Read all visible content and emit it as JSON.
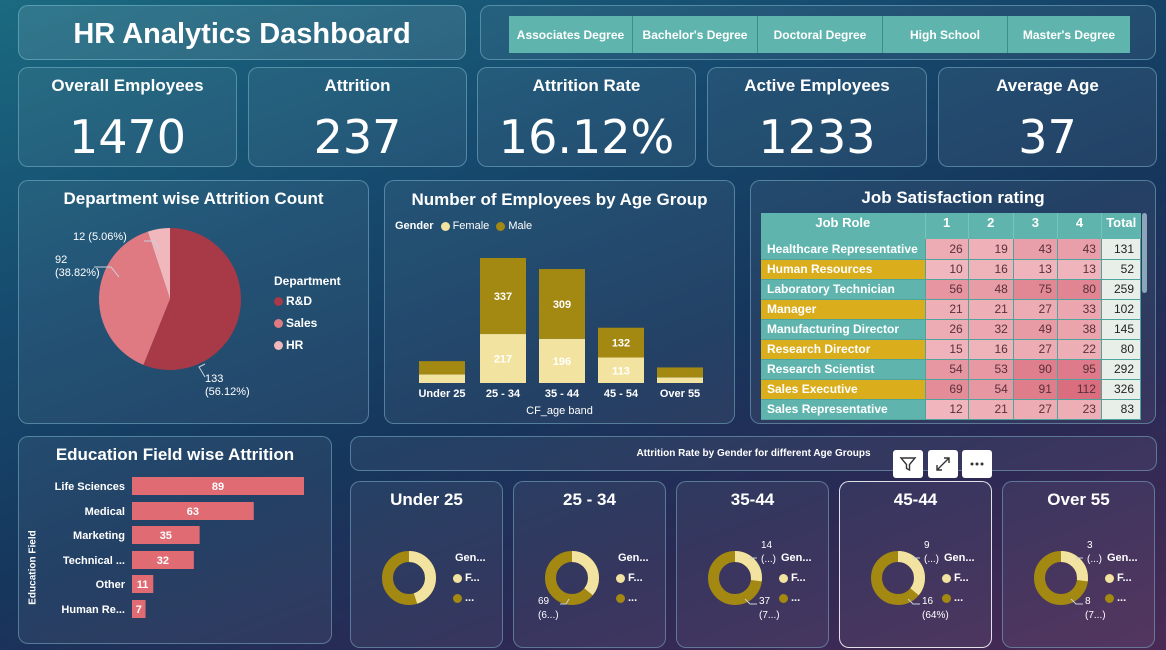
{
  "header": {
    "title": "HR Analytics Dashboard"
  },
  "slicer": {
    "options": [
      "Associates Degree",
      "Bachelor's Degree",
      "Doctoral Degree",
      "High School",
      "Master's Degree"
    ]
  },
  "kpis": [
    {
      "label": "Overall Employees",
      "value": "1470"
    },
    {
      "label": "Attrition",
      "value": "237"
    },
    {
      "label": "Attrition Rate",
      "value": "16.12%"
    },
    {
      "label": "Active Employees",
      "value": "1233"
    },
    {
      "label": "Average Age",
      "value": "37"
    }
  ],
  "dept_chart": {
    "title": "Department wise Attrition Count",
    "legend_title": "Department",
    "colors": {
      "R&D": "#a83a48",
      "Sales": "#e07a82",
      "HR": "#f0b8bc"
    },
    "chart_data": {
      "type": "pie",
      "categories": [
        "R&D",
        "Sales",
        "HR"
      ],
      "values": [
        133,
        92,
        12
      ],
      "labels": [
        "133\n(56.12%)",
        "92\n(38.82%)",
        "12 (5.06%)"
      ]
    },
    "labels": {
      "rd_value": "133",
      "rd_pct": "(56.12%)",
      "sales_value": "92",
      "sales_pct": "(38.82%)",
      "hr_label": "12 (5.06%)"
    }
  },
  "age_chart": {
    "title": "Number of Employees by Age Group",
    "legend_title": "Gender",
    "legend": [
      "Female",
      "Male"
    ],
    "xlabel": "CF_age band",
    "colors": {
      "Female": "#f3e3a0",
      "Male": "#a38811"
    },
    "chart_data": {
      "type": "bar",
      "stacked": true,
      "categories": [
        "Under 25",
        "25 - 34",
        "35 - 44",
        "45 - 54",
        "Over 55"
      ],
      "series": [
        {
          "name": "Female",
          "values": [
            38,
            217,
            196,
            113,
            25
          ]
        },
        {
          "name": "Male",
          "values": [
            59,
            337,
            309,
            132,
            44
          ]
        }
      ],
      "data_labels": {
        "Female": [
          "",
          "217",
          "196",
          "113",
          ""
        ],
        "Male": [
          "",
          "337",
          "309",
          "132",
          ""
        ]
      }
    }
  },
  "job_sat": {
    "title": "Job Satisfaction rating",
    "headers": [
      "Job Role",
      "1",
      "2",
      "3",
      "4",
      "Total"
    ],
    "rows": [
      {
        "role": "Healthcare Representative",
        "v": [
          "26",
          "19",
          "43",
          "43"
        ],
        "total": "131"
      },
      {
        "role": "Human Resources",
        "v": [
          "10",
          "16",
          "13",
          "13"
        ],
        "total": "52"
      },
      {
        "role": "Laboratory Technician",
        "v": [
          "56",
          "48",
          "75",
          "80"
        ],
        "total": "259"
      },
      {
        "role": "Manager",
        "v": [
          "21",
          "21",
          "27",
          "33"
        ],
        "total": "102"
      },
      {
        "role": "Manufacturing Director",
        "v": [
          "26",
          "32",
          "49",
          "38"
        ],
        "total": "145"
      },
      {
        "role": "Research Director",
        "v": [
          "15",
          "16",
          "27",
          "22"
        ],
        "total": "80"
      },
      {
        "role": "Research Scientist",
        "v": [
          "54",
          "53",
          "90",
          "95"
        ],
        "total": "292"
      },
      {
        "role": "Sales Executive",
        "v": [
          "69",
          "54",
          "91",
          "112"
        ],
        "total": "326"
      },
      {
        "role": "Sales Representative",
        "v": [
          "12",
          "21",
          "27",
          "23"
        ],
        "total": "83"
      }
    ]
  },
  "edu_chart": {
    "title": "Education Field wise Attrition",
    "ylabel": "Education Field",
    "color": "#e06b73",
    "chart_data": {
      "type": "bar",
      "orientation": "horizontal",
      "categories": [
        "Life Sciences",
        "Medical",
        "Marketing",
        "Technical ...",
        "Other",
        "Human Re..."
      ],
      "values": [
        89,
        63,
        35,
        32,
        11,
        7
      ]
    }
  },
  "gender_section": {
    "title": "Attrition Rate by Gender for different Age Groups",
    "legend_title": "Gen...",
    "legend_items": [
      "F...",
      "..."
    ],
    "colors": {
      "female": "#f3e3a0",
      "male": "#a38811"
    },
    "cards": [
      {
        "title": "Under 25",
        "female": 0.45,
        "male": 0.55,
        "labels": []
      },
      {
        "title": "25 - 34",
        "female": 0.36,
        "male": 0.64,
        "labels": [
          "69",
          "(6...)"
        ]
      },
      {
        "title": "35-44",
        "female": 0.27,
        "male": 0.73,
        "labels": [
          "14",
          "(...)",
          "37",
          "(7...)"
        ]
      },
      {
        "title": "45-44",
        "female": 0.36,
        "male": 0.64,
        "labels": [
          "9",
          "(...)",
          "16",
          "(64%)"
        ]
      },
      {
        "title": "Over 55",
        "female": 0.27,
        "male": 0.73,
        "labels": [
          "3",
          "(...)",
          "8",
          "(7...)"
        ]
      }
    ]
  }
}
